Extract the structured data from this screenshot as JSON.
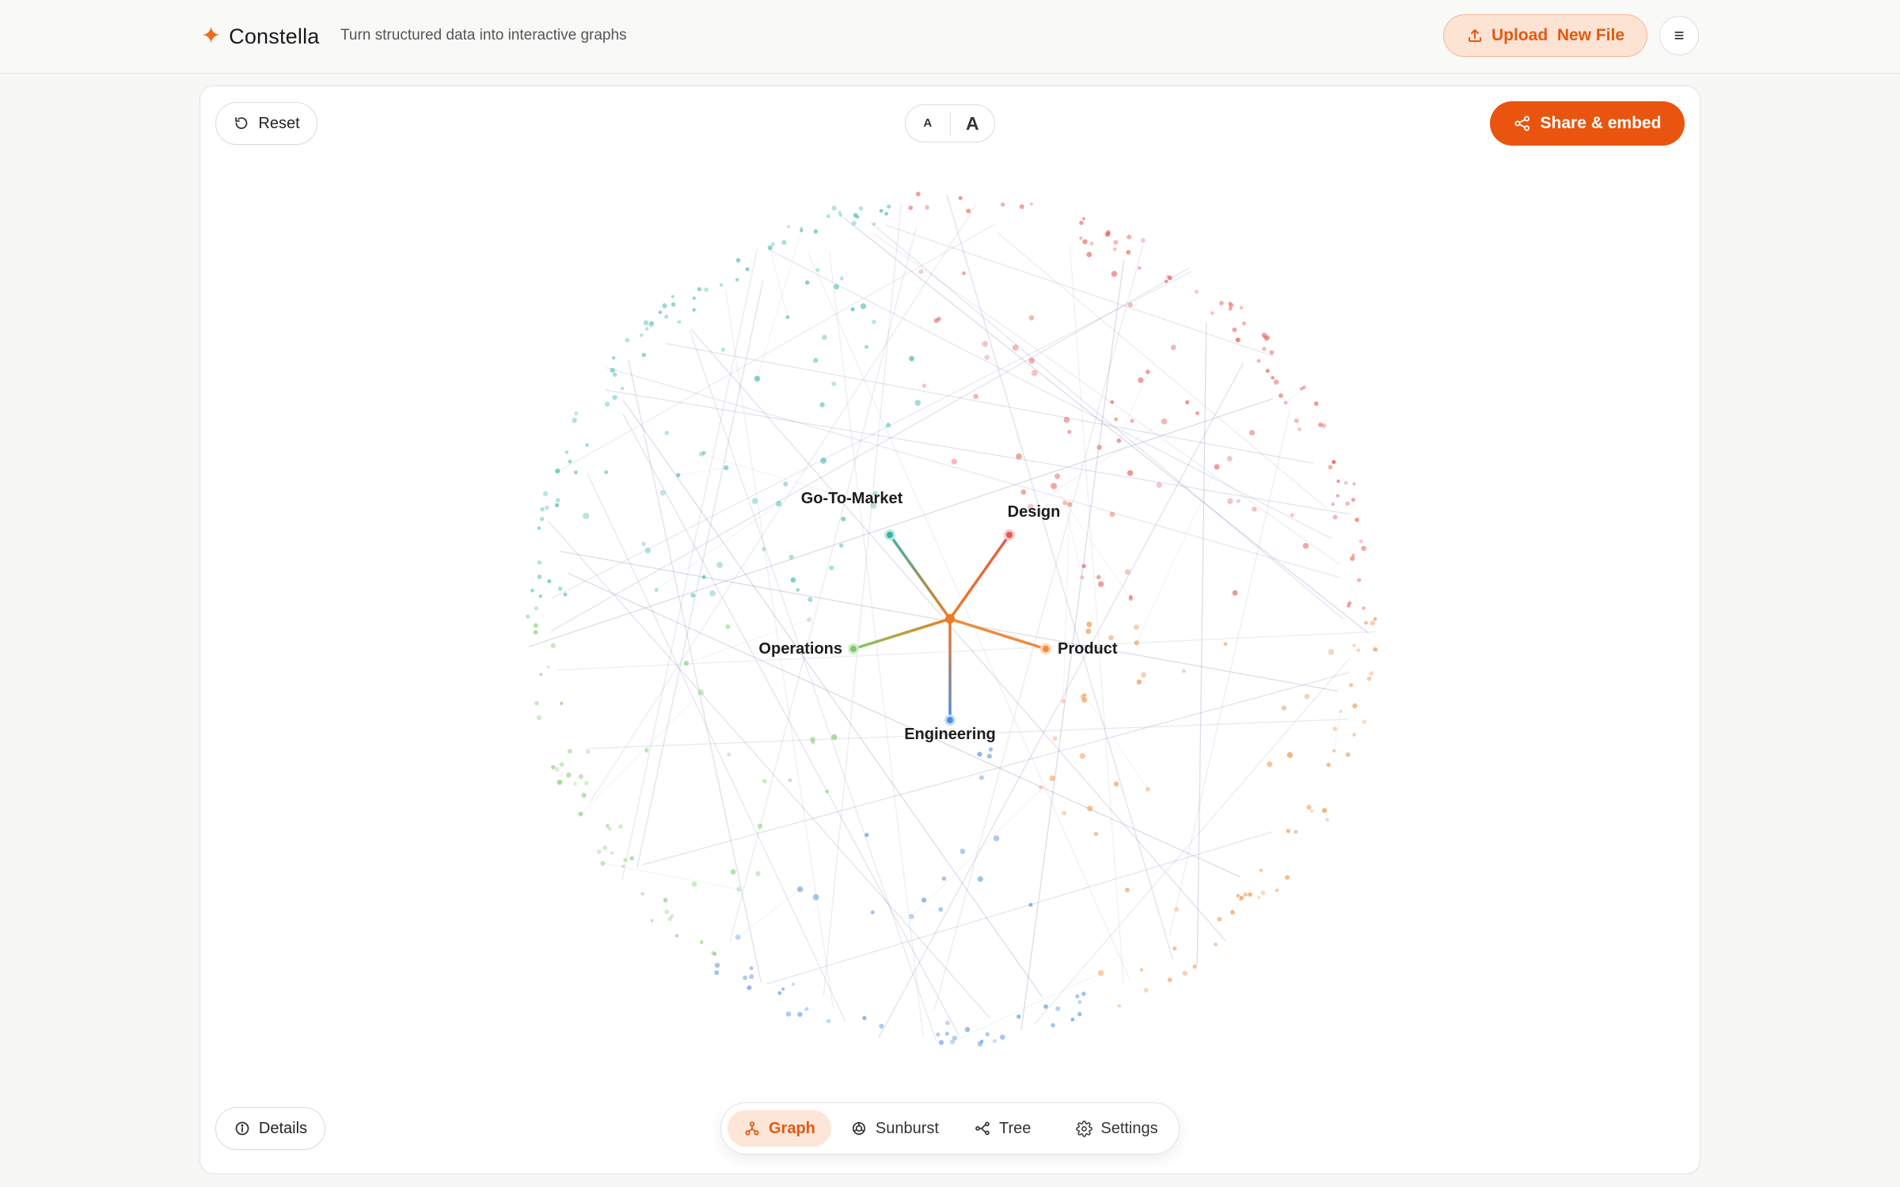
{
  "header": {
    "brand_icon": "sparkle-icon",
    "brand_name": "Constella",
    "tagline": "Turn structured data into interactive graphs",
    "upload_label": "Upload  New File",
    "menu_icon": "hamburger-menu-icon"
  },
  "toolbar": {
    "reset_label": "Reset",
    "font_small": "A",
    "font_large": "A",
    "share_label": "Share & embed",
    "details_label": "Details"
  },
  "graph": {
    "center_color": "#f07a22",
    "branches": [
      {
        "label": "Go-To-Market",
        "color": "#36b3a3"
      },
      {
        "label": "Design",
        "color": "#e35a55"
      },
      {
        "label": "Product",
        "color": "#ef8a3c"
      },
      {
        "label": "Engineering",
        "color": "#4a8de0"
      },
      {
        "label": "Operations",
        "color": "#7cc96a"
      }
    ]
  },
  "bottom_nav": {
    "items": [
      {
        "label": "Graph",
        "icon": "graph-icon",
        "active": true
      },
      {
        "label": "Sunburst",
        "icon": "sunburst-icon",
        "active": false
      },
      {
        "label": "Tree",
        "icon": "tree-icon",
        "active": false
      },
      {
        "label": "Settings",
        "icon": "gear-icon",
        "active": false
      }
    ]
  },
  "colors": {
    "accent": "#e9550f",
    "accent_soft": "#fce3d4"
  }
}
